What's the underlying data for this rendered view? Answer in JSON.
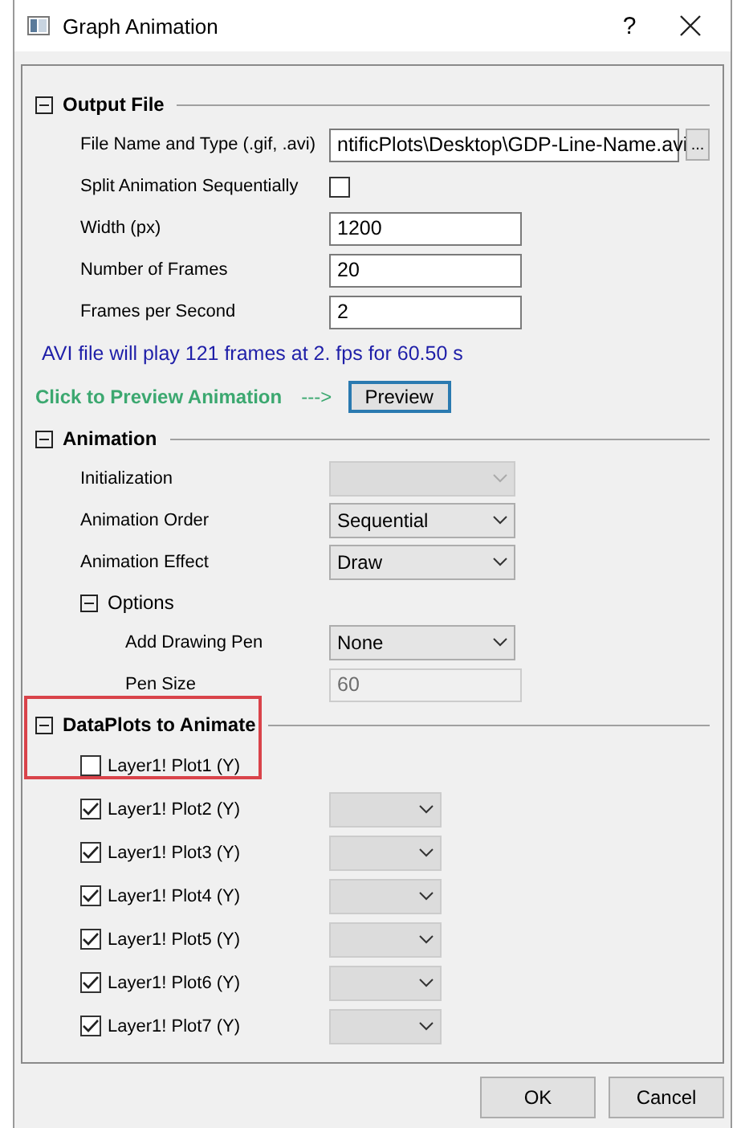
{
  "window": {
    "title": "Graph Animation",
    "help": "?"
  },
  "output_file": {
    "title": "Output File",
    "expanded": true,
    "rows": [
      {
        "kind": "file",
        "label": "File Name and Type (.gif, .avi)",
        "value": "ntificPlots\\Desktop\\GDP-Line-Name.avi",
        "browse": "..."
      },
      {
        "kind": "checkbox",
        "label": "Split Animation Sequentially",
        "checked": false
      },
      {
        "kind": "field",
        "label": "Width (px)",
        "value": "1200",
        "disabled": false
      },
      {
        "kind": "field",
        "label": "Number of Frames",
        "value": "20",
        "disabled": false
      },
      {
        "kind": "field",
        "label": "Frames per Second",
        "value": "2",
        "disabled": false
      }
    ],
    "info": "AVI file will play 121 frames at 2. fps for 60.50 s",
    "preview_hint": "Click to Preview Animation",
    "preview_arrow": "--->",
    "preview_button": "Preview"
  },
  "animation": {
    "title": "Animation",
    "expanded": true,
    "rows": [
      {
        "kind": "dropdown",
        "label": "Initialization",
        "disabled": true
      },
      {
        "kind": "dropdown",
        "label": "Animation Order",
        "value": "Sequential",
        "disabled": false
      },
      {
        "kind": "dropdown",
        "label": "Animation Effect",
        "value": "Draw",
        "disabled": false
      }
    ],
    "options": {
      "title": "Options",
      "expanded": true,
      "rows": [
        {
          "kind": "dropdown",
          "label": "Add Drawing Pen",
          "value": "None",
          "disabled": false
        },
        {
          "kind": "field",
          "label": "Pen Size",
          "value": "60",
          "disabled": true
        }
      ]
    }
  },
  "dataplots": {
    "title": "DataPlots to Animate",
    "expanded": true,
    "highlighted": true,
    "plots": [
      {
        "label": "Layer1! Plot1 (Y)",
        "checked": false,
        "dropdown": false
      },
      {
        "label": "Layer1! Plot2 (Y)",
        "checked": true,
        "dropdown": true
      },
      {
        "label": "Layer1! Plot3 (Y)",
        "checked": true,
        "dropdown": true
      },
      {
        "label": "Layer1! Plot4 (Y)",
        "checked": true,
        "dropdown": true
      },
      {
        "label": "Layer1! Plot5 (Y)",
        "checked": true,
        "dropdown": true
      },
      {
        "label": "Layer1! Plot6 (Y)",
        "checked": true,
        "dropdown": true
      },
      {
        "label": "Layer1! Plot7 (Y)",
        "checked": true,
        "dropdown": true
      }
    ]
  },
  "buttons": [
    {
      "label": "OK"
    },
    {
      "label": "Cancel"
    }
  ]
}
